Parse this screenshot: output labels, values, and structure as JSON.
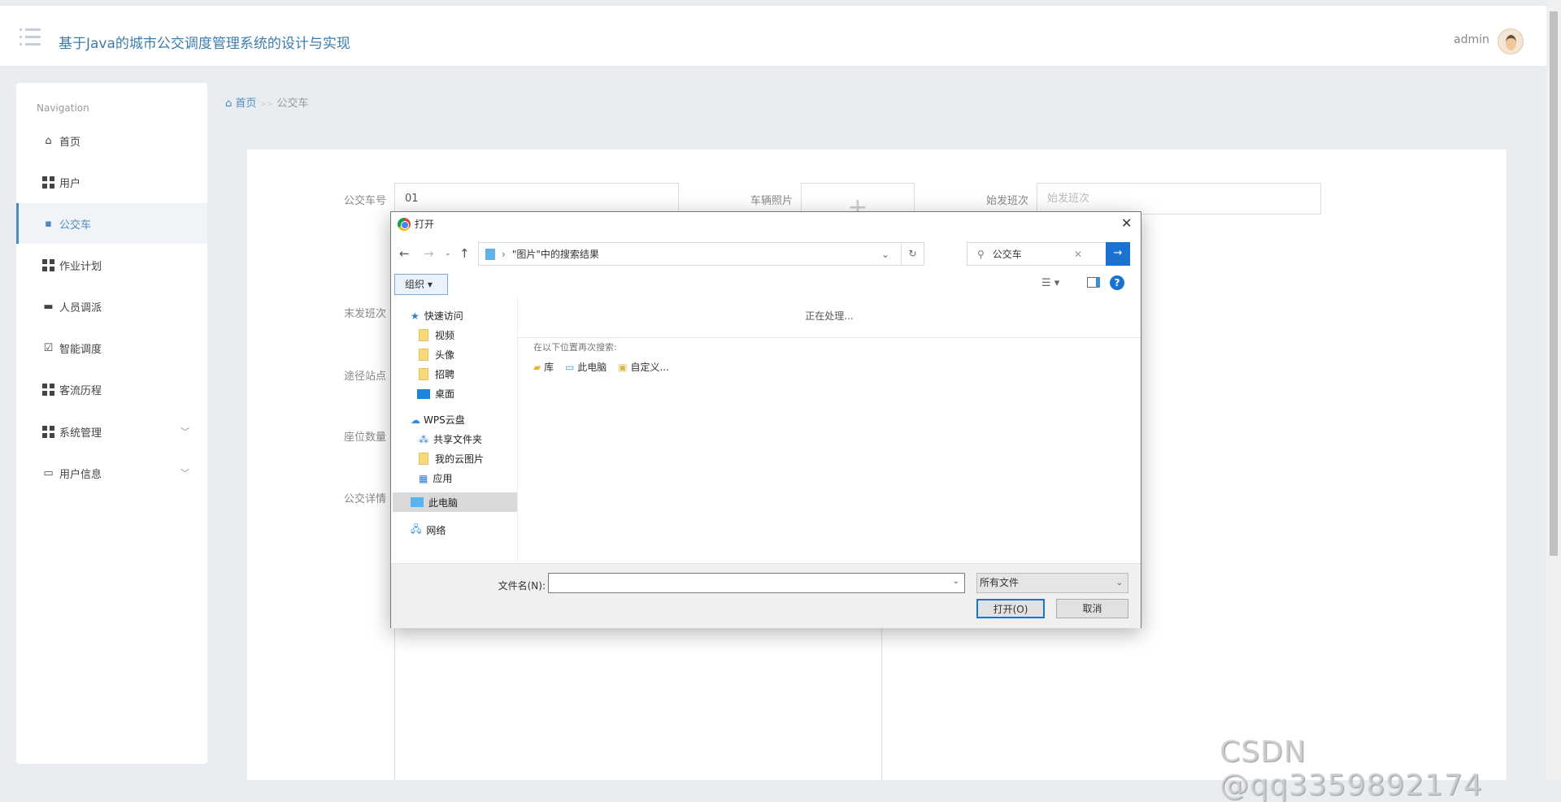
{
  "header": {
    "title": "基于Java的城市公交调度管理系统的设计与实现",
    "user": "admin"
  },
  "sidebar": {
    "label": "Navigation",
    "items": [
      {
        "label": "首页",
        "icon": "home-icon"
      },
      {
        "label": "用户",
        "icon": "grid-icon"
      },
      {
        "label": "公交车",
        "icon": "chat-icon",
        "active": true
      },
      {
        "label": "作业计划",
        "icon": "grid-icon"
      },
      {
        "label": "人员调派",
        "icon": "briefcase-icon"
      },
      {
        "label": "智能调度",
        "icon": "clipboard-icon"
      },
      {
        "label": "客流历程",
        "icon": "grid-icon"
      },
      {
        "label": "系统管理",
        "icon": "grid-icon",
        "expandable": true
      },
      {
        "label": "用户信息",
        "icon": "card-icon",
        "expandable": true
      }
    ]
  },
  "breadcrumb": {
    "home": "首页",
    "sep": ">>",
    "current": "公交车"
  },
  "form": {
    "bus_no_label": "公交车号",
    "bus_no_value": "01",
    "photo_label": "车辆照片",
    "photo_plus": "+",
    "first_label": "始发班次",
    "first_placeholder": "始发班次",
    "last_label": "末发班次",
    "stops_label": "途径站点",
    "seats_label": "座位数量",
    "detail_label": "公交详情"
  },
  "dialog": {
    "title": "打开",
    "path": "\"图片\"中的搜索结果",
    "search": "公交车",
    "organize": "组织 ▾",
    "processing": "正在处理...",
    "search_again": "在以下位置再次搜索:",
    "locations": [
      "库",
      "此电脑",
      "自定义..."
    ],
    "tree": [
      {
        "label": "快速访问",
        "type": "star"
      },
      {
        "label": "视频",
        "type": "folder"
      },
      {
        "label": "头像",
        "type": "folder"
      },
      {
        "label": "招聘",
        "type": "folder"
      },
      {
        "label": "桌面",
        "type": "desktop"
      },
      {
        "label": "WPS云盘",
        "type": "cloud"
      },
      {
        "label": "共享文件夹",
        "type": "share"
      },
      {
        "label": "我的云图片",
        "type": "folder"
      },
      {
        "label": "应用",
        "type": "apps"
      },
      {
        "label": "此电脑",
        "type": "pc",
        "selected": true
      },
      {
        "label": "网络",
        "type": "network"
      }
    ],
    "filename_label": "文件名(N):",
    "filename_value": "",
    "filetype": "所有文件",
    "open": "打开(O)",
    "cancel": "取消"
  },
  "watermark": "CSDN @qq3359892174"
}
